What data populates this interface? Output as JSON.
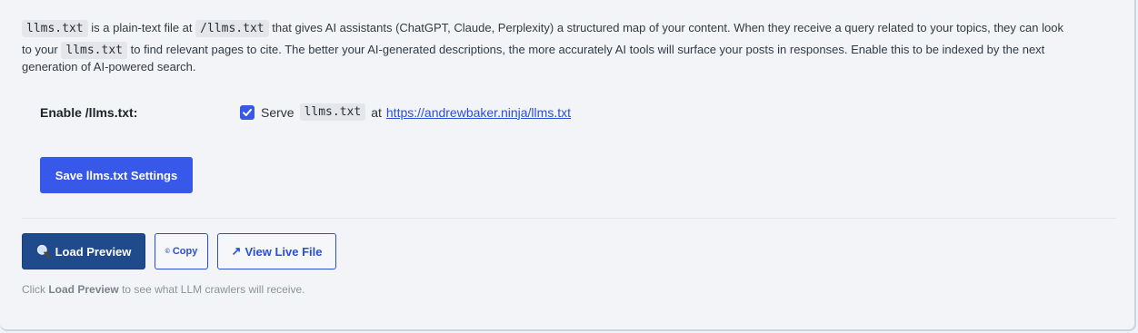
{
  "intro": {
    "code_llms": "llms.txt",
    "t1": "is a plain-text file at",
    "code_path": "/llms.txt",
    "t2": "that gives AI assistants (ChatGPT, Claude, Perplexity) a structured map of your content. When they receive a query related to your topics, they can look",
    "t3": "to your",
    "code_llms2": "llms.txt",
    "t4": "to find relevant pages to cite. The better your AI-generated descriptions, the more accurately AI tools will surface your posts in responses. Enable this to be indexed by the next",
    "t5": "generation of AI-powered search."
  },
  "setting": {
    "label": "Enable /llms.txt:",
    "checked": true,
    "serve_text": "Serve",
    "serve_code": "llms.txt",
    "at_text": "at",
    "url": "https://andrewbaker.ninja/llms.txt"
  },
  "buttons": {
    "save": "Save llms.txt Settings",
    "load_preview": "Load Preview",
    "copy": "Copy",
    "view_live": "View Live File"
  },
  "icons": {
    "load_preview": "magnifier-icon",
    "copy": "copyright-glyph-icon",
    "view_live": "arrow-up-right-icon"
  },
  "hint": {
    "prefix": "Click",
    "bold": "Load Preview",
    "suffix": "to see what LLM crawlers will receive."
  },
  "colors": {
    "primary": "#3858e9",
    "preview_button": "#1f4a8c",
    "link": "#2b4ed8",
    "background": "#f2f4f8"
  }
}
